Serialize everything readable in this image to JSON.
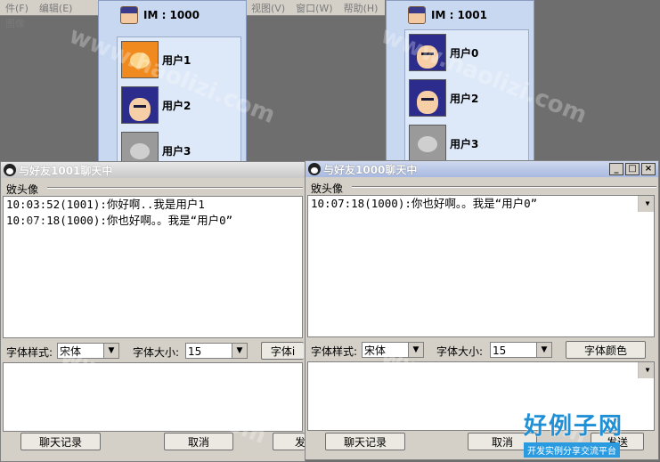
{
  "background_menu": {
    "left": [
      "件(F)",
      "编辑(E)",
      "图像"
    ],
    "right": [
      "视图(V)",
      "窗口(W)",
      "帮助(H)"
    ]
  },
  "buddy_left": {
    "im_label": "IM : 1000",
    "users": [
      "用户1",
      "用户2",
      "用户3"
    ]
  },
  "buddy_right": {
    "im_label": "IM : 1001",
    "users": [
      "用户0",
      "用户2",
      "用户3"
    ]
  },
  "chat_left": {
    "title": "与好友1001聊天中",
    "toolbar_label": "敓头像",
    "messages": [
      "10:03:52(1001):你好啊..我是用户1",
      "10:07:18(1000):你也好啊。。我是“用户0”"
    ],
    "font_style_label": "字体样式:",
    "font_style_value": "宋体",
    "font_size_label": "字体大小:",
    "font_size_value": "15",
    "font_color_button": "字体i",
    "history_button": "聊天记录",
    "cancel_button": "取消",
    "send_button": "发"
  },
  "chat_right": {
    "title": "与好友1000聊天中",
    "toolbar_label": "敓头像",
    "messages": [
      "10:07:18(1000):你也好啊。。我是“用户0”"
    ],
    "font_style_label": "字体样式:",
    "font_style_value": "宋体",
    "font_size_label": "字体大小:",
    "font_size_value": "15",
    "font_color_button": "字体颜色",
    "history_button": "聊天记录",
    "cancel_button": "取消",
    "send_button": "发送",
    "window_controls": [
      "_",
      "□",
      "×"
    ]
  },
  "watermark": {
    "text": "www.haolizi.com",
    "logo_main": "好例子网",
    "logo_sub": "开发实例分享交流平台"
  }
}
